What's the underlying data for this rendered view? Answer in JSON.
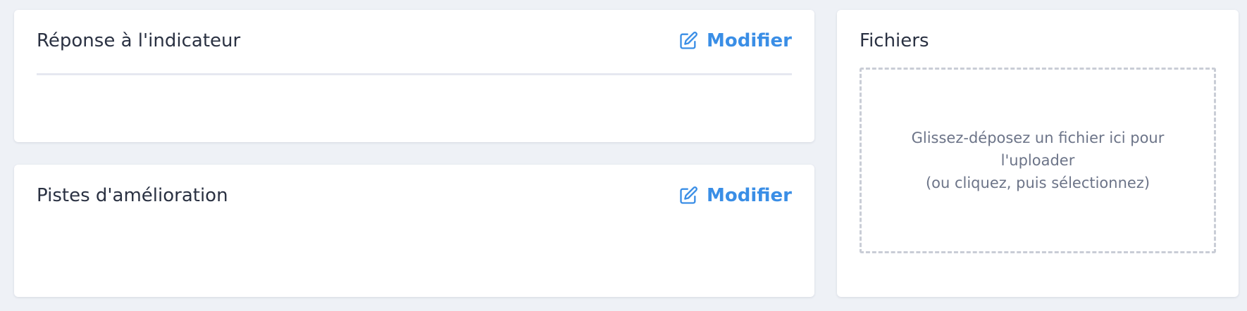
{
  "response_card": {
    "title": "Réponse à l'indicateur",
    "edit_label": "Modifier"
  },
  "improvement_card": {
    "title": "Pistes d'amélioration",
    "edit_label": "Modifier"
  },
  "files_card": {
    "title": "Fichiers",
    "dropzone_line1": "Glissez-déposez un fichier ici pour l'uploader",
    "dropzone_line2": "(ou cliquez, puis sélectionnez)"
  },
  "colors": {
    "accent": "#3a8ee6",
    "background": "#eef1f6",
    "card": "#ffffff",
    "title_text": "#2a3142",
    "muted_text": "#6c7488"
  },
  "icons": {
    "edit": "edit-icon"
  }
}
